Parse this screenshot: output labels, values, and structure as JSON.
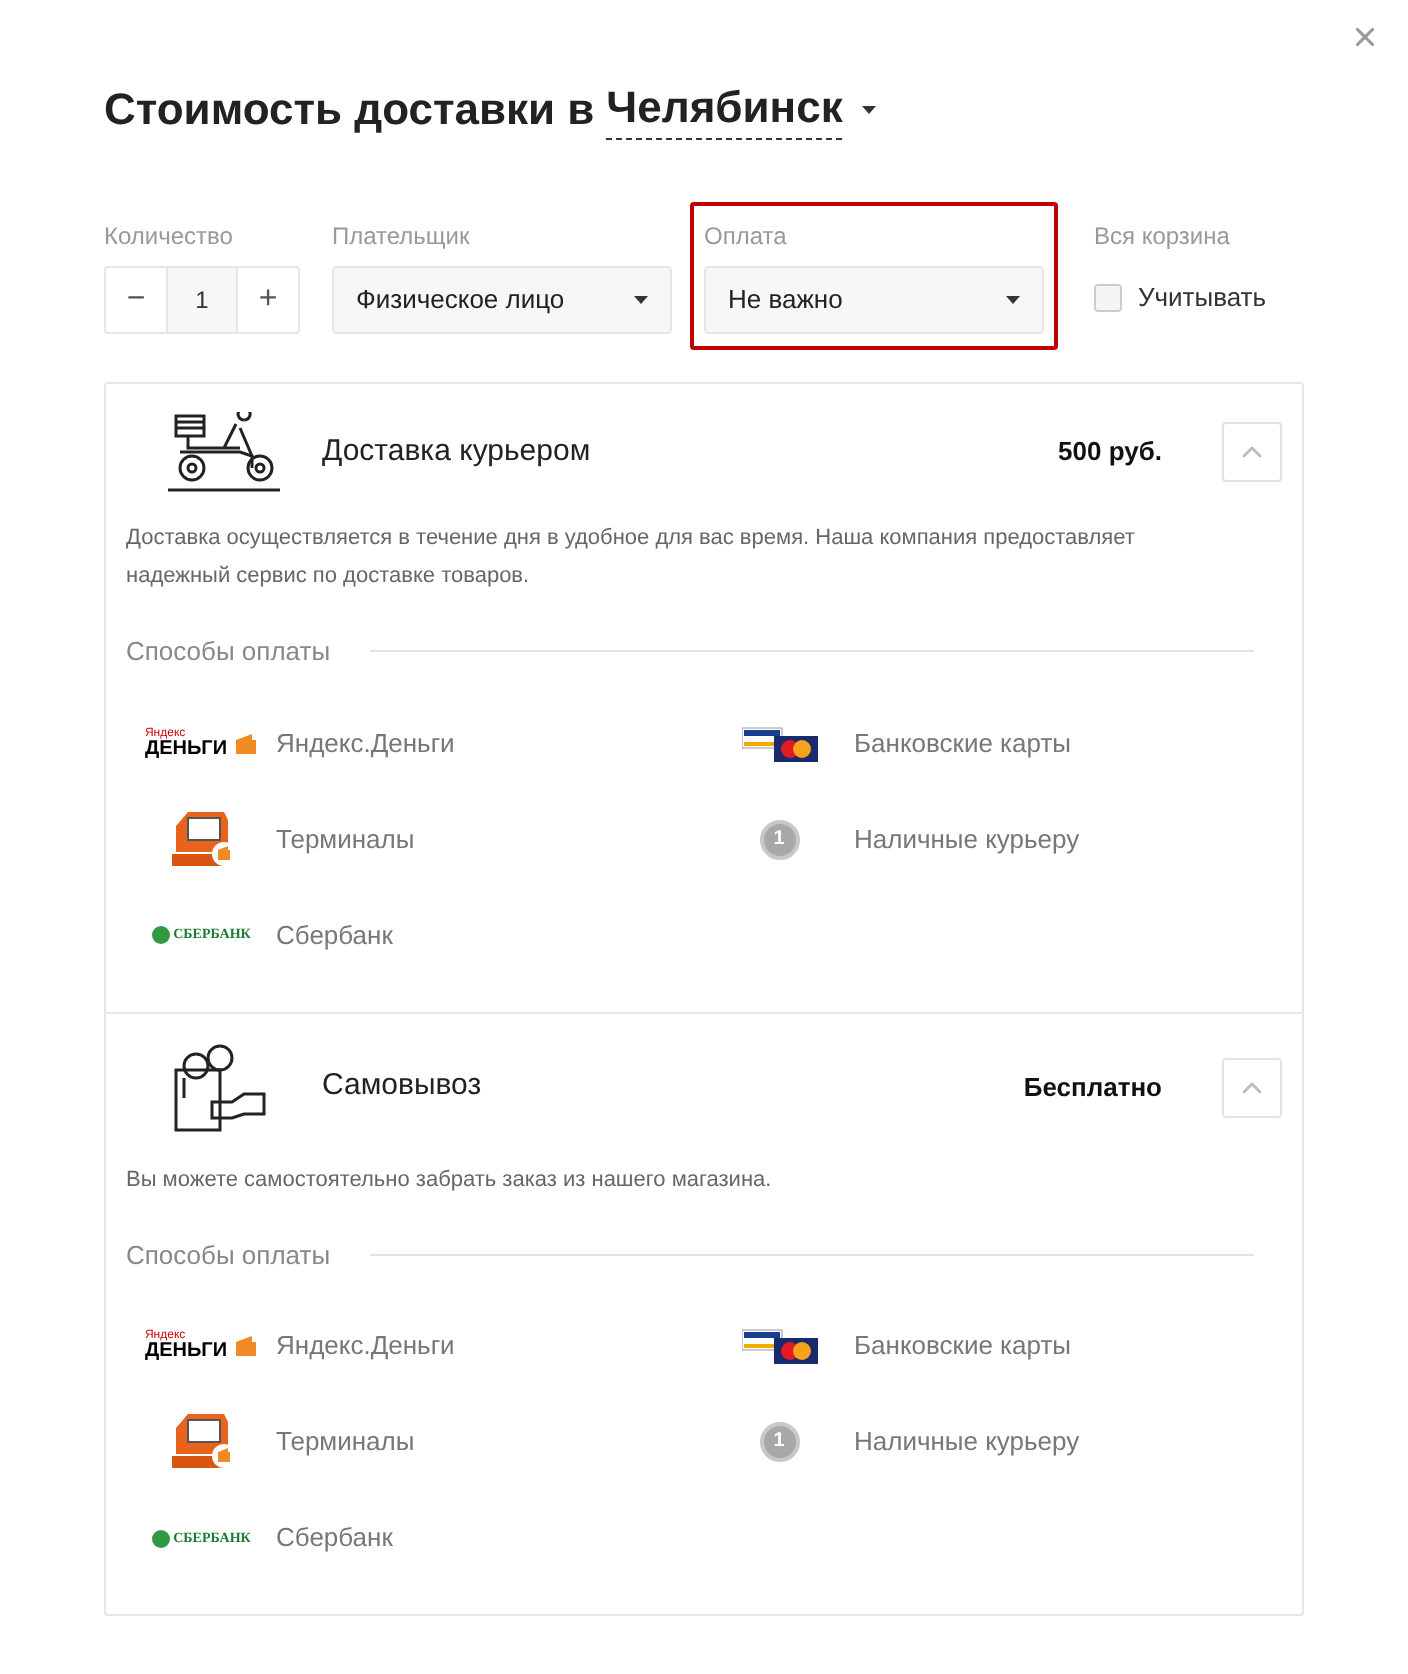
{
  "title": {
    "text": "Стоимость доставки в",
    "city": "Челябинск"
  },
  "filters": {
    "quantity": {
      "label": "Количество",
      "value": "1",
      "minus": "−",
      "plus": "+"
    },
    "payer": {
      "label": "Плательщик",
      "value": "Физическое лицо"
    },
    "payment": {
      "label": "Оплата",
      "value": "Не важно",
      "highlighted": true
    },
    "cart": {
      "label": "Вся корзина",
      "checkbox_label": "Учитывать",
      "checked": false
    }
  },
  "methods": [
    {
      "kind": "courier",
      "name": "Доставка курьером",
      "price": "500 руб.",
      "expanded": true,
      "description": "Доставка осуществляется в течение дня в удобное для вас время. Наша компания предоставляет надежный сервис по доставке товаров.",
      "payments_heading": "Способы оплаты",
      "payments": [
        {
          "kind": "yandex",
          "label": "Яндекс.Деньги",
          "logo_text": [
            "Яндекс",
            "ДЕНЬГИ"
          ]
        },
        {
          "kind": "cards",
          "label": "Банковские карты"
        },
        {
          "kind": "terminal",
          "label": "Терминалы"
        },
        {
          "kind": "cash",
          "label": "Наличные курьеру",
          "logo_text": [
            "1"
          ]
        },
        {
          "kind": "sberbank",
          "label": "Сбербанк",
          "logo_text": [
            "СБЕРБАНК"
          ]
        }
      ]
    },
    {
      "kind": "pickup",
      "name": "Самовывоз",
      "price": "Бесплатно",
      "expanded": true,
      "description": "Вы можете самостоятельно забрать заказ из нашего магазина.",
      "payments_heading": "Способы оплаты",
      "payments": [
        {
          "kind": "yandex",
          "label": "Яндекс.Деньги",
          "logo_text": [
            "Яндекс",
            "ДЕНЬГИ"
          ]
        },
        {
          "kind": "cards",
          "label": "Банковские карты"
        },
        {
          "kind": "terminal",
          "label": "Терминалы"
        },
        {
          "kind": "cash",
          "label": "Наличные курьеру",
          "logo_text": [
            "1"
          ]
        },
        {
          "kind": "sberbank",
          "label": "Сбербанк",
          "logo_text": [
            "СБЕРБАНК"
          ]
        }
      ]
    }
  ]
}
